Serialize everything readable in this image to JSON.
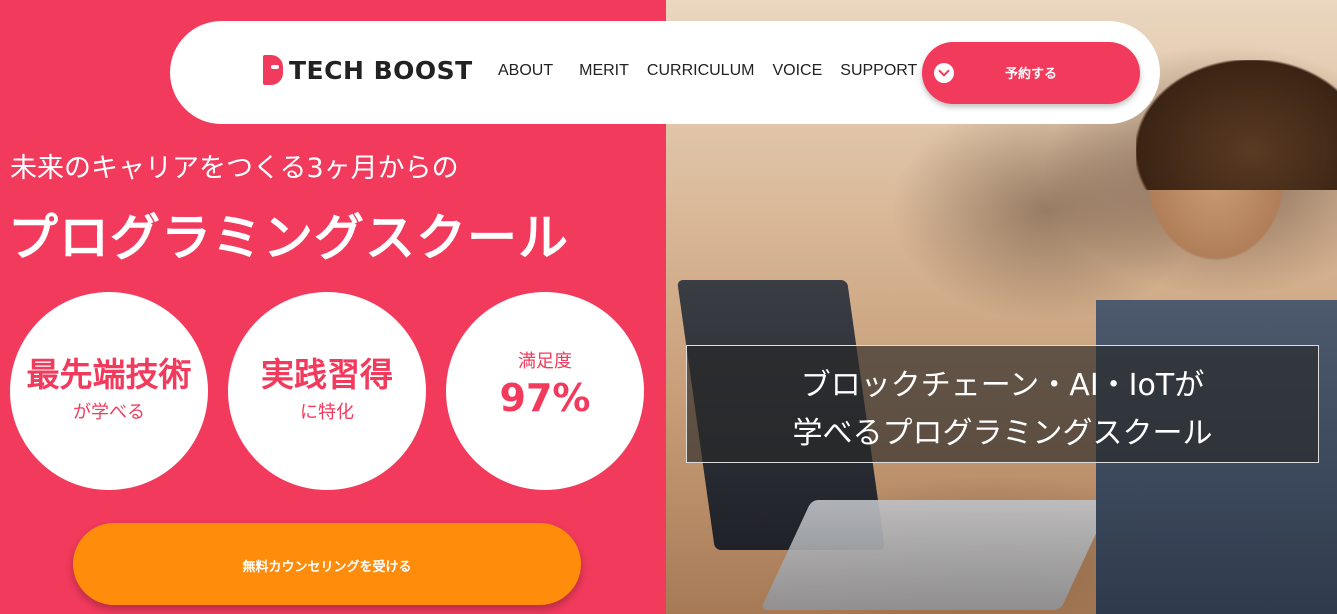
{
  "header": {
    "logo_text": "TECH BOOST",
    "nav": [
      "ABOUT",
      "MERIT",
      "CURRICULUM",
      "VOICE",
      "SUPPORT"
    ],
    "reserve_label": "予約する"
  },
  "hero": {
    "tagline": "未来のキャリアをつくる3ヶ月からの",
    "headline": "プログラミングスクール",
    "circles": [
      {
        "main": "最先端技術",
        "sub": "が学べる"
      },
      {
        "main": "実践習得",
        "sub": "に特化"
      },
      {
        "top": "満足度",
        "big": "97%"
      }
    ],
    "cta_label": "無料カウンセリングを受ける"
  },
  "overlay": {
    "line1": "ブロックチェーン・AI・IoTが",
    "line2": "学べるプログラミングスクール"
  },
  "colors": {
    "brand_pink": "#f23a5c",
    "cta_orange": "#ff8c0b"
  }
}
